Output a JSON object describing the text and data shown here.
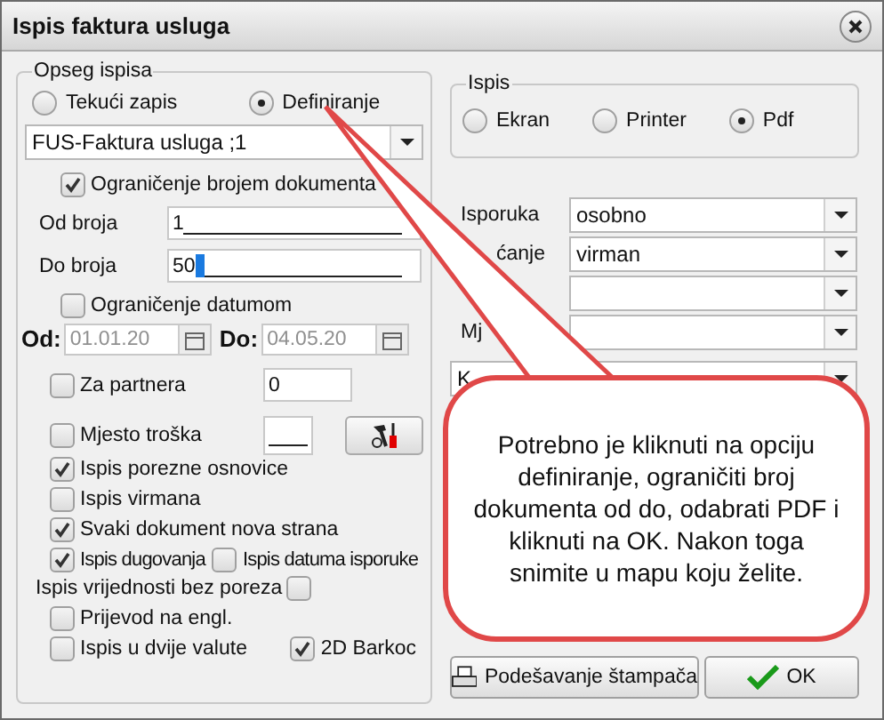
{
  "window": {
    "title": "Ispis faktura usluga"
  },
  "scope": {
    "legend": "Opseg ispisa",
    "options": [
      {
        "label": "Tekući zapis",
        "selected": false
      },
      {
        "label": "Definiranje",
        "selected": true
      }
    ],
    "document_type": {
      "value": "FUS-Faktura usluga ;1"
    },
    "limit_by_number": {
      "label": "Ograničenje brojem dokumenta",
      "checked": true
    },
    "from_number": {
      "label": "Od broja",
      "value": "1"
    },
    "to_number": {
      "label": "Do broja",
      "value": "50"
    },
    "limit_by_date": {
      "label": "Ograničenje datumom",
      "checked": false
    },
    "date_from": {
      "label": "Od:",
      "value": "01.01.20"
    },
    "date_to": {
      "label": "Do:",
      "value": "04.05.20"
    },
    "partner": {
      "label": "Za partnera",
      "checked": false,
      "value": "0"
    },
    "cost_center": {
      "label": "Mjesto troška",
      "checked": false
    },
    "checks": [
      {
        "label": "Ispis porezne osnovice",
        "checked": true
      },
      {
        "label": "Ispis virmana",
        "checked": false
      },
      {
        "label": "Svaki dokument nova strana",
        "checked": true
      }
    ],
    "debts": {
      "label": "Ispis dugovanja",
      "checked": true
    },
    "delivery_date": {
      "label": "Ispis datuma isporuke",
      "checked": false
    },
    "no_tax": {
      "label": "Ispis vrijednosti bez poreza",
      "checked": false
    },
    "translate": {
      "label": "Prijevod na engl.",
      "checked": false
    },
    "two_currencies": {
      "label": "Ispis u dvije valute",
      "checked": false
    },
    "barcode": {
      "label": "2D Barkoc",
      "checked": true
    }
  },
  "output": {
    "legend": "Ispis",
    "options": [
      {
        "label": "Ekran",
        "selected": false
      },
      {
        "label": "Printer",
        "selected": false
      },
      {
        "label": "Pdf",
        "selected": true
      }
    ]
  },
  "fields": [
    {
      "kind": "dropdown",
      "label": "Isporuka",
      "value": "osobno"
    },
    {
      "kind": "dropdown",
      "label": "ćanje",
      "value": "virman"
    },
    {
      "kind": "dropdown"
    },
    {
      "kind": "dropdown",
      "label": "Mj"
    }
  ],
  "wide_combo": {
    "value": "K"
  },
  "buttons": [
    {
      "kind": "printer",
      "label": "Podešavanje štampača"
    },
    {
      "kind": "ok",
      "label": "OK"
    }
  ],
  "callout": {
    "text": "Potrebno je kliknuti na opciju definiranje, ograničiti broj dokumenta od do, odabrati PDF i kliknuti na OK. Nakon toga snimite u mapu koju želite."
  }
}
